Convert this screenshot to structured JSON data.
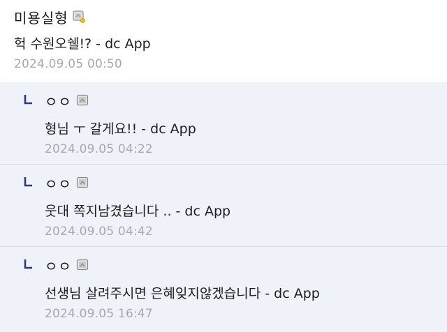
{
  "comment": {
    "nickname": "미용실형",
    "text": "헉 수원오쉘!? - dc App",
    "date": "2024.09.05 00:50",
    "badge_icon": "gallog-fixed-nick-icon"
  },
  "replies": [
    {
      "nickname": "ㅇㅇ",
      "text": "형님 ㅜ 갈게요!! - dc App",
      "date": "2024.09.05 04:22",
      "badge_icon": "gallog-nick-icon",
      "reply_icon": "reply-arrow-icon"
    },
    {
      "nickname": "ㅇㅇ",
      "text": "웃대 쪽지남겼습니다 .. - dc App",
      "date": "2024.09.05 04:42",
      "badge_icon": "gallog-nick-icon",
      "reply_icon": "reply-arrow-icon"
    },
    {
      "nickname": "ㅇㅇ",
      "text": "선생님 살려주시면 은혜잊지않겠습니다 - dc App",
      "date": "2024.09.05 16:47",
      "badge_icon": "gallog-nick-icon",
      "reply_icon": "reply-arrow-icon"
    }
  ],
  "colors": {
    "reply_background": "#eff2f8",
    "date_text": "#a7a9ad",
    "reply_arrow": "#2c3a7a"
  }
}
